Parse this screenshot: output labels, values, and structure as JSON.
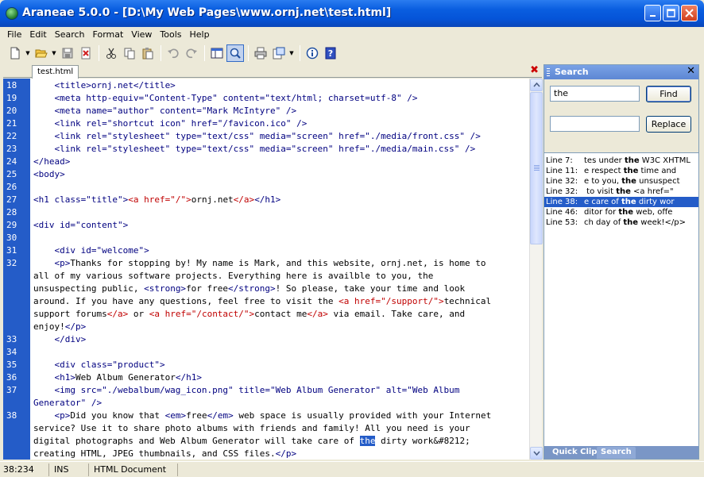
{
  "window": {
    "title": "Araneae 5.0.0 - [D:\\My Web Pages\\www.ornj.net\\test.html]"
  },
  "menu": [
    "File",
    "Edit",
    "Search",
    "Format",
    "View",
    "Tools",
    "Help"
  ],
  "tab": {
    "label": "test.html"
  },
  "editor": {
    "lines": [
      {
        "n": "18",
        "parts": [
          [
            "t",
            "    <title>ornj.net</title>"
          ]
        ]
      },
      {
        "n": "19",
        "parts": [
          [
            "t",
            "    <meta http-equiv=\"Content-Type\" content=\"text/html; charset=utf-8\" />"
          ]
        ]
      },
      {
        "n": "20",
        "parts": [
          [
            "t",
            "    <meta name=\"author\" content=\"Mark McIntyre\" />"
          ]
        ]
      },
      {
        "n": "21",
        "parts": [
          [
            "t",
            "    <link rel=\"shortcut icon\" href=\"/favicon.ico\" />"
          ]
        ]
      },
      {
        "n": "22",
        "parts": [
          [
            "t",
            "    <link rel=\"stylesheet\" type=\"text/css\" media=\"screen\" href=\"./media/front.css\" />"
          ]
        ]
      },
      {
        "n": "23",
        "parts": [
          [
            "t",
            "    <link rel=\"stylesheet\" type=\"text/css\" media=\"screen\" href=\"./media/main.css\" />"
          ]
        ]
      },
      {
        "n": "24",
        "parts": [
          [
            "t",
            "</head>"
          ]
        ]
      },
      {
        "n": "25",
        "parts": [
          [
            "t",
            "<body>"
          ]
        ]
      },
      {
        "n": "26",
        "parts": [
          [
            "t",
            ""
          ]
        ]
      },
      {
        "n": "27",
        "parts": [
          [
            "t",
            "<h1 class=\"title\">"
          ],
          [
            "l",
            "<a href=\"/\">"
          ],
          [
            "x",
            "ornj.net"
          ],
          [
            "l",
            "</a>"
          ],
          [
            "t",
            "</h1>"
          ]
        ]
      },
      {
        "n": "28",
        "parts": [
          [
            "t",
            ""
          ]
        ]
      },
      {
        "n": "29",
        "parts": [
          [
            "t",
            "<div id=\"content\">"
          ]
        ]
      },
      {
        "n": "30",
        "parts": [
          [
            "t",
            ""
          ]
        ]
      },
      {
        "n": "31",
        "parts": [
          [
            "t",
            "    <div id=\"welcome\">"
          ]
        ]
      },
      {
        "n": "32",
        "parts": [
          [
            "t",
            "    <p>"
          ],
          [
            "x",
            "Thanks for stopping by! My name is Mark, and this website, ornj.net, is home to"
          ]
        ]
      },
      {
        "n": "",
        "parts": [
          [
            "x",
            "all of my various software projects. Everything here is availble to you, the"
          ]
        ]
      },
      {
        "n": "",
        "parts": [
          [
            "x",
            "unsuspecting public, "
          ],
          [
            "t",
            "<strong>"
          ],
          [
            "x",
            "for free"
          ],
          [
            "t",
            "</strong>"
          ],
          [
            "x",
            "! So please, take your time and look"
          ]
        ]
      },
      {
        "n": "",
        "parts": [
          [
            "x",
            "around. If you have any questions, feel free to visit the "
          ],
          [
            "l",
            "<a href=\"/support/\">"
          ],
          [
            "x",
            "technical"
          ]
        ]
      },
      {
        "n": "",
        "parts": [
          [
            "x",
            "support forums"
          ],
          [
            "l",
            "</a>"
          ],
          [
            "x",
            " or "
          ],
          [
            "l",
            "<a href=\"/contact/\">"
          ],
          [
            "x",
            "contact me"
          ],
          [
            "l",
            "</a>"
          ],
          [
            "x",
            " via email. Take care, and"
          ]
        ]
      },
      {
        "n": "",
        "parts": [
          [
            "x",
            "enjoy!"
          ],
          [
            "t",
            "</p>"
          ]
        ]
      },
      {
        "n": "33",
        "parts": [
          [
            "t",
            "    </div>"
          ]
        ]
      },
      {
        "n": "34",
        "parts": [
          [
            "t",
            ""
          ]
        ]
      },
      {
        "n": "35",
        "parts": [
          [
            "t",
            "    <div class=\"product\">"
          ]
        ]
      },
      {
        "n": "36",
        "parts": [
          [
            "t",
            "    <h1>"
          ],
          [
            "x",
            "Web Album Generator"
          ],
          [
            "t",
            "</h1>"
          ]
        ]
      },
      {
        "n": "37",
        "parts": [
          [
            "t",
            "    <img src=\"./webalbum/wag_icon.png\" title=\"Web Album Generator\" alt=\"Web Album"
          ]
        ]
      },
      {
        "n": "",
        "parts": [
          [
            "t",
            "Generator\" />"
          ]
        ]
      },
      {
        "n": "38",
        "parts": [
          [
            "t",
            "    <p>"
          ],
          [
            "x",
            "Did you know that "
          ],
          [
            "t",
            "<em>"
          ],
          [
            "x",
            "free"
          ],
          [
            "t",
            "</em>"
          ],
          [
            "x",
            " web space is usually provided with your Internet"
          ]
        ]
      },
      {
        "n": "",
        "parts": [
          [
            "x",
            "service? Use it to share photo albums with friends and family! All you need is your"
          ]
        ]
      },
      {
        "n": "",
        "parts": [
          [
            "x",
            "digital photographs and Web Album Generator will take care of "
          ],
          [
            "h",
            "the"
          ],
          [
            "x",
            " dirty work&#8212;"
          ]
        ]
      },
      {
        "n": "",
        "parts": [
          [
            "x",
            "creating HTML, JPEG thumbnails, and CSS files."
          ],
          [
            "t",
            "</p>"
          ]
        ]
      }
    ]
  },
  "search_panel": {
    "title": "Search",
    "find_value": "the",
    "find_button": "Find",
    "replace_value": "",
    "replace_button": "Replace",
    "results": [
      {
        "line": "Line 7:",
        "before": "tes under ",
        "match": "the",
        "after": " W3C XHTML",
        "selected": false
      },
      {
        "line": "Line 11:",
        "before": "e respect ",
        "match": "the",
        "after": " time and",
        "selected": false
      },
      {
        "line": "Line 32:",
        "before": "e to you, ",
        "match": "the",
        "after": " unsuspect",
        "selected": false
      },
      {
        "line": "Line 32:",
        "before": " to visit ",
        "match": "the",
        "after": " <a href=\"",
        "selected": false
      },
      {
        "line": "Line 38:",
        "before": "e care of ",
        "match": "the",
        "after": " dirty wor",
        "selected": true
      },
      {
        "line": "Line 46:",
        "before": "ditor for ",
        "match": "the",
        "after": " web, offe",
        "selected": false
      },
      {
        "line": "Line 53:",
        "before": "ch day of ",
        "match": "the",
        "after": " week!</p>",
        "selected": false
      }
    ],
    "tabs": [
      "Quick Clips",
      "Search"
    ]
  },
  "status": {
    "position": "38:234",
    "mode": "INS",
    "doctype": "HTML Document"
  }
}
